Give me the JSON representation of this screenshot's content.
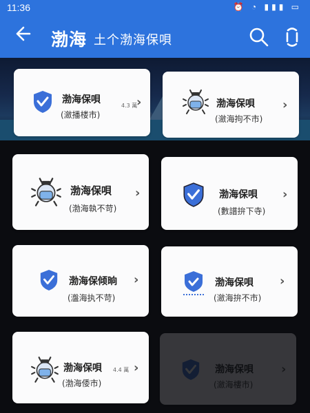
{
  "status": {
    "time": "11:36"
  },
  "header": {
    "title": "渤海",
    "subtitle": "土个渤海保唄"
  },
  "cards": [
    {
      "name": "渤海保唄",
      "sub": "(瀲播楼市)",
      "meta": "4.3 萬",
      "icon": "shield-icon"
    },
    {
      "name": "渤海保唄",
      "sub": "(瀲海拘不市)",
      "meta": "",
      "icon": "robot-mask-icon"
    },
    {
      "name": "渤海保唄",
      "sub": "(渤海執不苛)",
      "meta": "",
      "icon": "robot-mask-icon"
    },
    {
      "name": "渤海保唄",
      "sub": "(數譜拚下寺)",
      "meta": "",
      "icon": "shield-icon"
    },
    {
      "name": "渤海保倾晌",
      "sub": "(瀊海执不苛)",
      "meta": "",
      "icon": "shield-icon"
    },
    {
      "name": "渤海保唄",
      "sub": "(瀲海拚不市)",
      "meta": "",
      "icon": "shield-badge-icon"
    },
    {
      "name": "渤海保唄",
      "sub": "(渤海倭市)",
      "meta": "4.4 萬",
      "icon": "robot-mask-icon"
    },
    {
      "name": "渤海保唄",
      "sub": "(瀲海樓市)",
      "meta": "",
      "icon": "shield-icon"
    }
  ],
  "colors": {
    "primary": "#2d73dd",
    "card": "#fbfbfc",
    "shield": "#3b6fd8"
  }
}
